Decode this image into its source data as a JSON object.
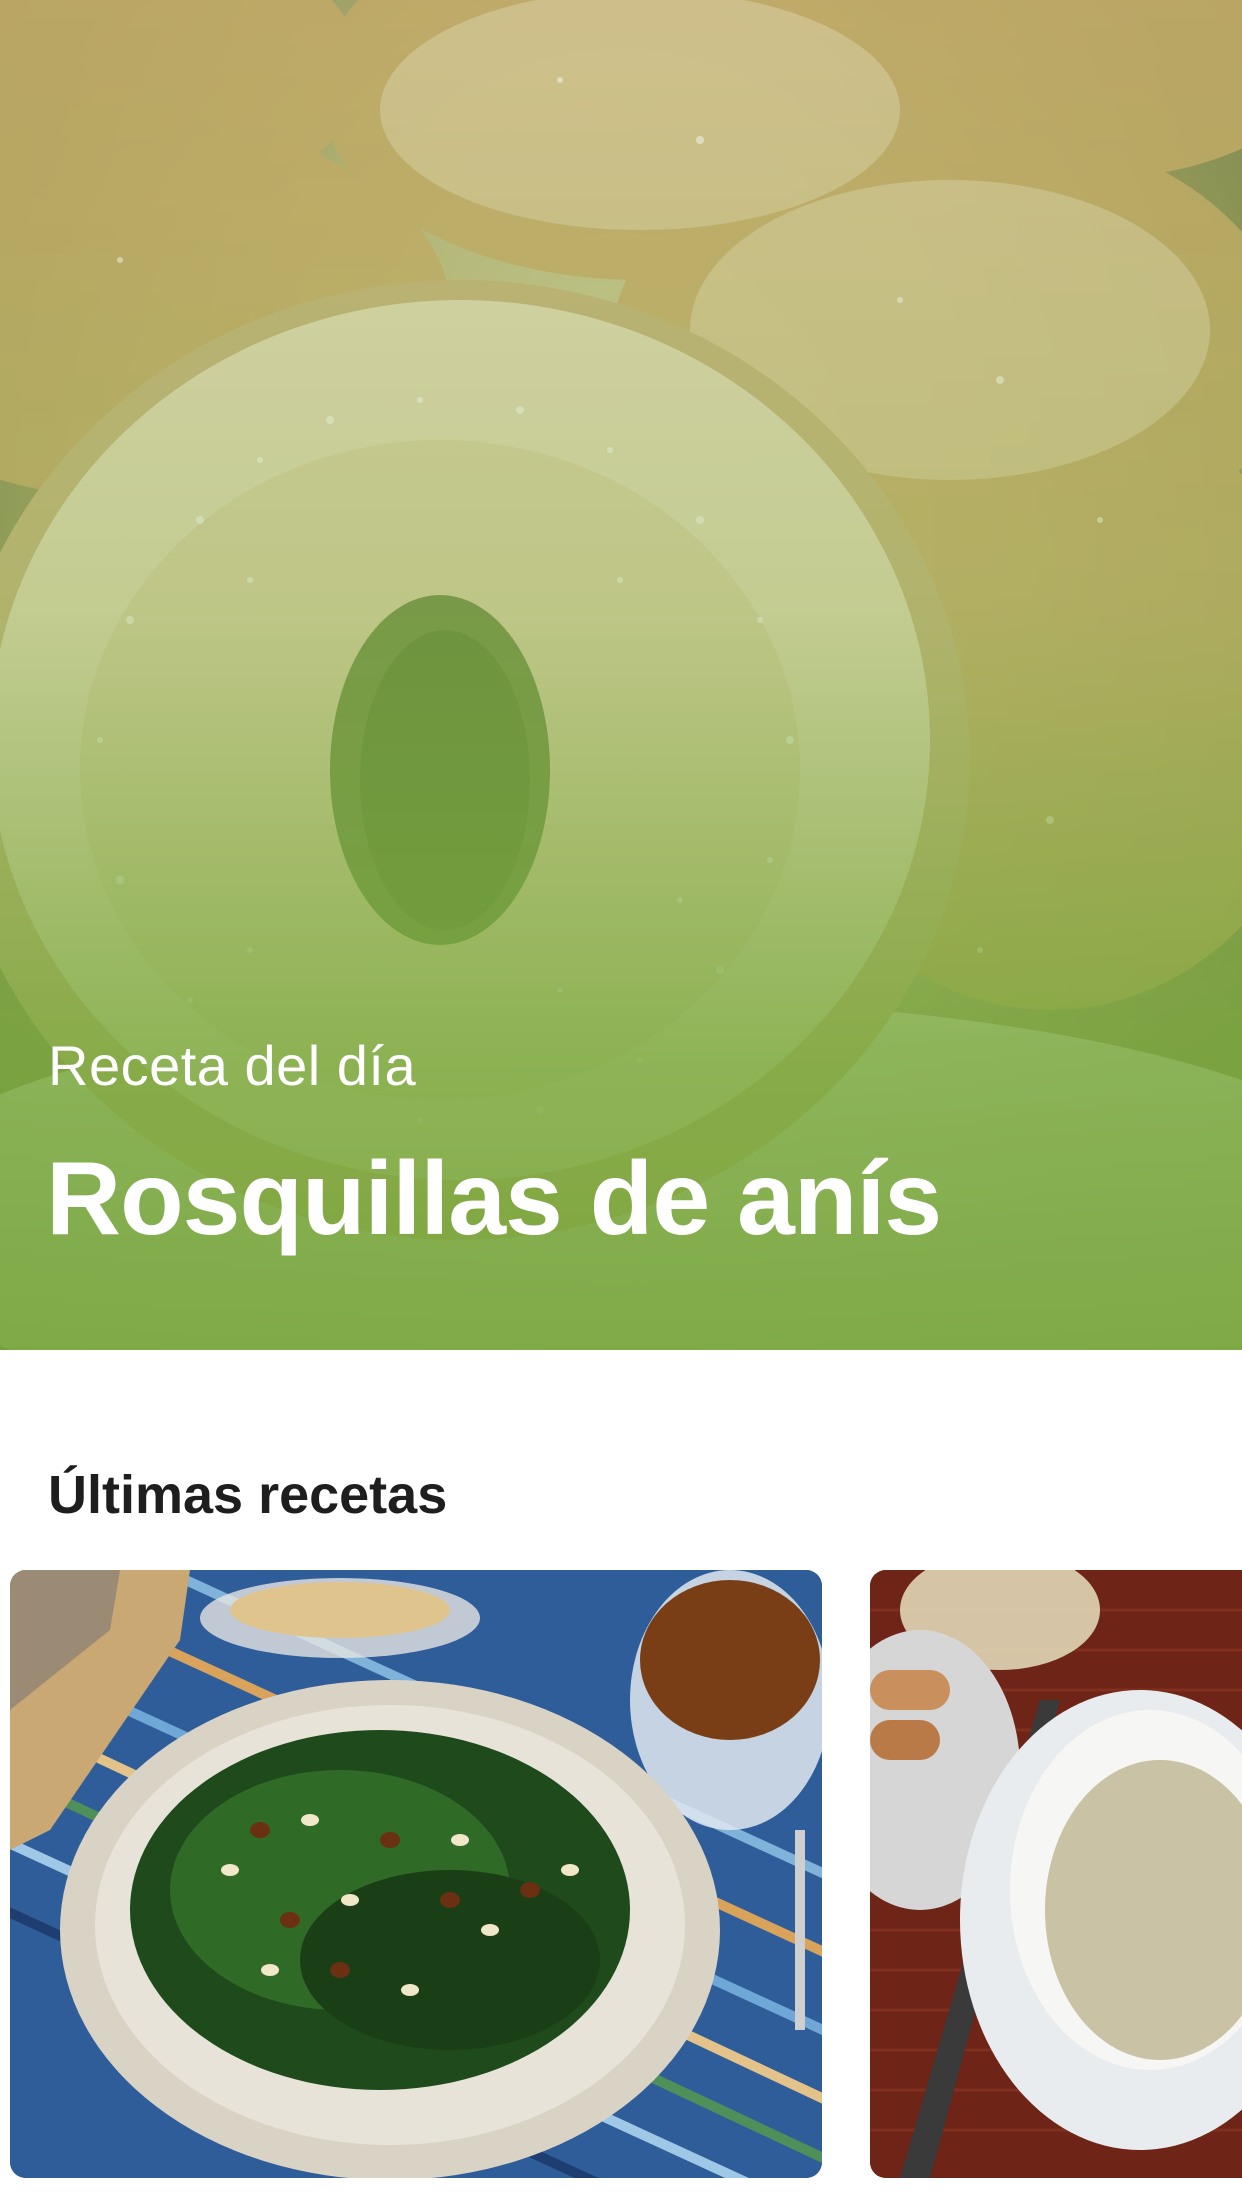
{
  "hero": {
    "kicker": "Receta del día",
    "title": "Rosquillas de anís",
    "overlay_color": "#7fb04a"
  },
  "latest": {
    "title": "Últimas recetas",
    "cards": [
      {
        "image": "spinach-raisins-pine-nuts-photo"
      },
      {
        "image": "cream-soup-sausages-photo"
      }
    ]
  }
}
